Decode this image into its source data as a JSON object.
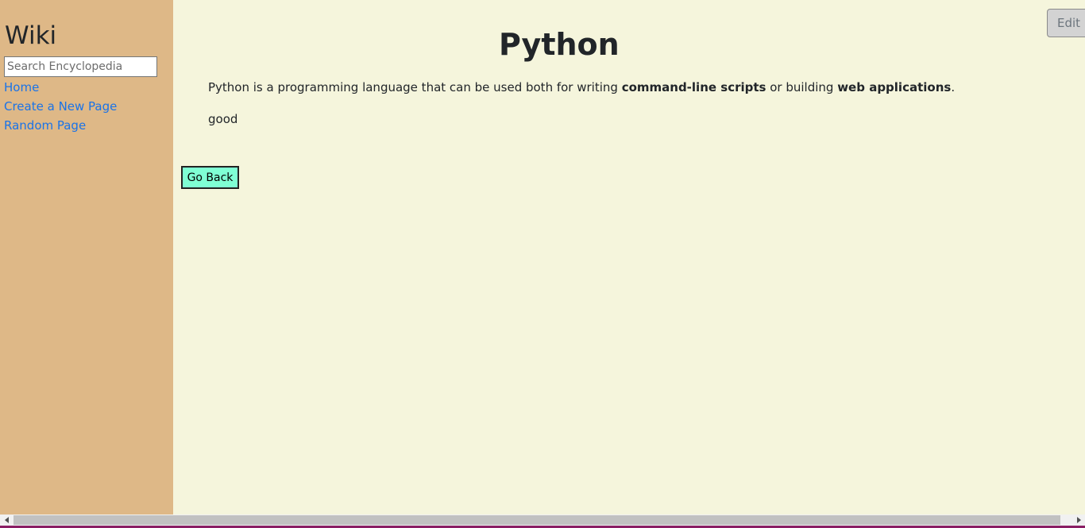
{
  "sidebar": {
    "title": "Wiki",
    "search": {
      "placeholder": "Search Encyclopedia",
      "value": ""
    },
    "links": {
      "home": "Home",
      "create": "Create a New Page",
      "random": "Random Page"
    }
  },
  "article": {
    "title": "Python",
    "paragraph1": {
      "part1": "Python is a programming language that can be used both for writing ",
      "bold1": "command-line scripts",
      "part2": " or building ",
      "bold2": "web applications",
      "part3": "."
    },
    "paragraph2": "good"
  },
  "buttons": {
    "go_back": "Go Back",
    "edit": "Edit"
  },
  "colors": {
    "page_background": "#f5f5dc",
    "sidebar_background": "#deb887",
    "link": "#1a73e8",
    "go_back_background": "#7fffd4",
    "edit_background": "#d3d3d3"
  },
  "icons": {
    "scroll_left": "triangle-left-icon",
    "scroll_right": "triangle-right-icon"
  }
}
